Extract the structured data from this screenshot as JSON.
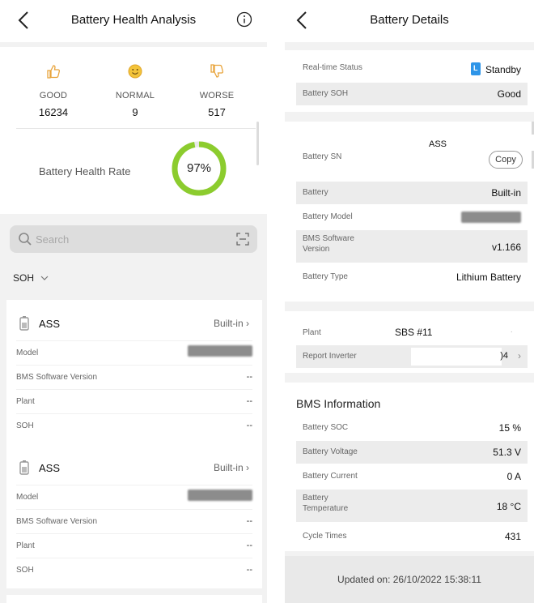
{
  "left": {
    "header": {
      "title": "Battery Health Analysis"
    },
    "stats": [
      {
        "label": "GOOD",
        "value": "16234",
        "icon": "thumbs-up-icon"
      },
      {
        "label": "NORMAL",
        "value": "9",
        "icon": "smile-icon"
      },
      {
        "label": "WORSE",
        "value": "517",
        "icon": "thumbs-down-icon"
      }
    ],
    "health_rate": {
      "label": "Battery Health Rate",
      "value": "97%",
      "fraction": 0.97,
      "color": "#8ccc2e"
    },
    "search": {
      "placeholder": "Search"
    },
    "sort": {
      "label": "SOH"
    },
    "cards": [
      {
        "name": "ASS",
        "type": "Built-in",
        "rows": [
          {
            "key": "Model",
            "value": ""
          },
          {
            "key": "BMS Software Version",
            "value": "--"
          },
          {
            "key": "Plant",
            "value": "--"
          },
          {
            "key": "SOH",
            "value": "--"
          }
        ]
      },
      {
        "name": "ASS",
        "type": "Built-in",
        "rows": [
          {
            "key": "Model",
            "value": ""
          },
          {
            "key": "BMS Software Version",
            "value": "--"
          },
          {
            "key": "Plant",
            "value": "--"
          },
          {
            "key": "SOH",
            "value": "--"
          }
        ]
      }
    ]
  },
  "right": {
    "header": {
      "title": "Battery Details"
    },
    "status": {
      "realtime_label": "Real-time Status",
      "realtime_value": "Standby",
      "soh_label": "Battery SOH",
      "soh_value": "Good"
    },
    "info": {
      "sn_label": "Battery SN",
      "sn_value": "ASS",
      "copy_label": "Copy",
      "battery_label": "Battery",
      "battery_value": "Built-in",
      "model_label": "Battery Model",
      "bms_label_1": "BMS Software",
      "bms_label_2": "Version",
      "bms_value": "v1.166",
      "type_label": "Battery Type",
      "type_value": "Lithium Battery"
    },
    "plant": {
      "plant_label": "Plant",
      "plant_value": "SBS  #11",
      "inverter_label": "Report Inverter",
      "inverter_value": ")4"
    },
    "bms": {
      "title": "BMS Information",
      "soc_label": "Battery SOC",
      "soc_value": "15 %",
      "voltage_label": "Battery Voltage",
      "voltage_value": "51.3 V",
      "current_label": "Battery Current",
      "current_value": "0 A",
      "temp_label_1": "Battery",
      "temp_label_2": "Temperature",
      "temp_value": "18 °C",
      "cycle_label": "Cycle Times",
      "cycle_value": "431"
    },
    "footer": {
      "updated": "Updated on: 26/10/2022 15:38:11"
    }
  }
}
